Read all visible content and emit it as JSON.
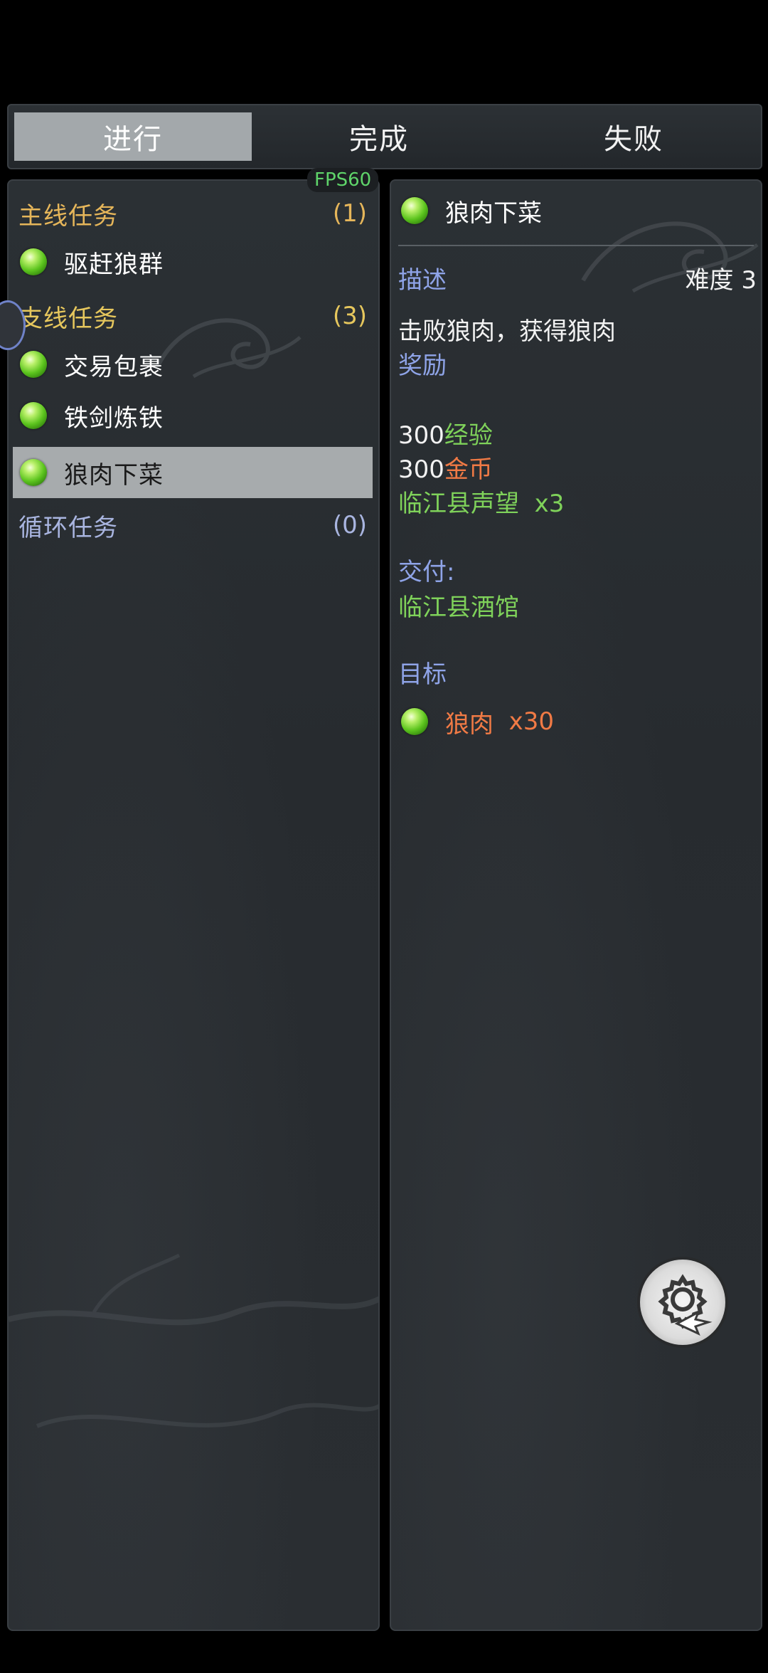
{
  "tabs": [
    {
      "label": "进行",
      "active": true
    },
    {
      "label": "完成",
      "active": false
    },
    {
      "label": "失败",
      "active": false
    }
  ],
  "fps": "FPS60",
  "categories": {
    "main": {
      "title": "主线任务",
      "count": "(1)"
    },
    "side": {
      "title": "支线任务",
      "count": "(3)"
    },
    "loop": {
      "title": "循环任务",
      "count": "(0)"
    }
  },
  "quests": {
    "main": [
      {
        "label": "驱赶狼群"
      }
    ],
    "side": [
      {
        "label": "交易包裹"
      },
      {
        "label": "铁剑炼铁"
      },
      {
        "label": "狼肉下菜"
      }
    ]
  },
  "detail": {
    "title": "狼肉下菜",
    "desc_label": "描述",
    "difficulty": "难度 3",
    "desc_text": "击败狼肉，获得狼肉",
    "reward_label": "奖励",
    "rewards": [
      {
        "amount": "300",
        "name": "经验"
      },
      {
        "amount": "300",
        "name": "金币"
      },
      {
        "name": "临江县声望",
        "qty": "x3"
      }
    ],
    "deliver_label": "交付:",
    "deliver_place": "临江县酒馆",
    "goal_label": "目标",
    "goal_item": "狼肉",
    "goal_qty": "x30"
  },
  "colors": {
    "bg": "#000000",
    "panel": "#2a2e32",
    "selected": "#a7abad",
    "category_gold": "#e6b65a",
    "label_blue": "#8fa4e8",
    "reward_green": "#7fd25a",
    "reward_orange": "#f07a45"
  },
  "icons": {
    "orb": "green-orb-icon",
    "settings": "gear-icon"
  }
}
